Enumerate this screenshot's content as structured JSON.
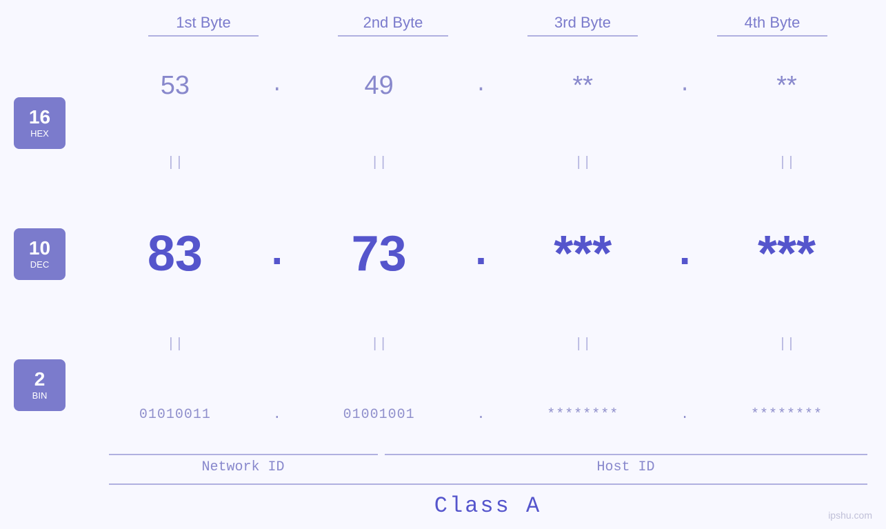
{
  "header": {
    "bytes": [
      {
        "label": "1st Byte"
      },
      {
        "label": "2nd Byte"
      },
      {
        "label": "3rd Byte"
      },
      {
        "label": "4th Byte"
      }
    ]
  },
  "badges": [
    {
      "number": "16",
      "type": "HEX"
    },
    {
      "number": "10",
      "type": "DEC"
    },
    {
      "number": "2",
      "type": "BIN"
    }
  ],
  "ip": {
    "hex": {
      "b1": "53",
      "b2": "49",
      "b3": "**",
      "b4": "**",
      "sep": "."
    },
    "dec": {
      "b1": "83",
      "b2": "73",
      "b3": "***",
      "b4": "***",
      "sep": "."
    },
    "bin": {
      "b1": "01010011",
      "b2": "01001001",
      "b3": "********",
      "b4": "********",
      "sep": "."
    }
  },
  "equals": "||",
  "labels": {
    "network_id": "Network ID",
    "host_id": "Host ID",
    "class": "Class A"
  },
  "watermark": "ipshu.com"
}
